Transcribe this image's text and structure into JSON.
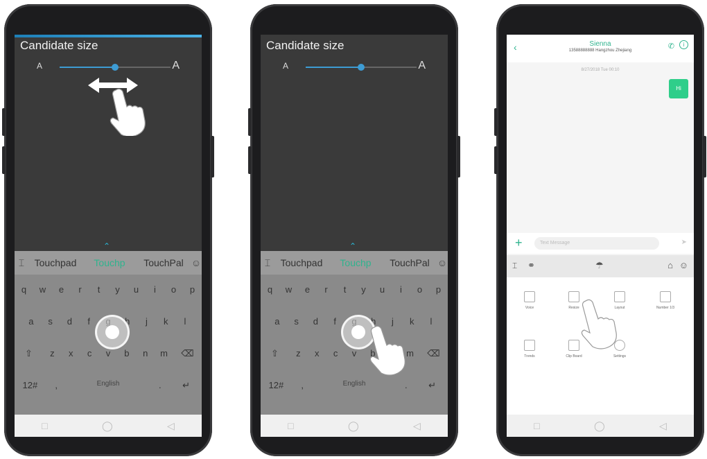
{
  "candidate_size": {
    "title": "Candidate size",
    "small_a": "A",
    "big_a": "A",
    "slider_level": 0.5
  },
  "keyboard": {
    "candidates": [
      "Touchpad",
      "Touchp",
      "TouchPal"
    ],
    "row1": [
      "q",
      "w",
      "e",
      "r",
      "t",
      "y",
      "u",
      "i",
      "o",
      "p"
    ],
    "row2": [
      "a",
      "s",
      "d",
      "f",
      "g",
      "h",
      "j",
      "k",
      "l"
    ],
    "row3": [
      "z",
      "x",
      "c",
      "v",
      "b",
      "n",
      "m"
    ],
    "num_key": "12#",
    "space_label": "English"
  },
  "chat": {
    "contact_name": "Sienna",
    "contact_sub": "13588888888 Hangzhou Zhejiang",
    "date": "8/27/2018 Tue 00:10",
    "message": "Hi",
    "input_placeholder": "Text Message",
    "panel_items": [
      "Voice",
      "Resize",
      "Layout",
      "Number 1/3",
      "Trends",
      "Clip Board",
      "Settings"
    ]
  },
  "colors": {
    "accent": "#2fb38e",
    "slider": "#3d9cd4",
    "bubble": "#2fce8a"
  }
}
